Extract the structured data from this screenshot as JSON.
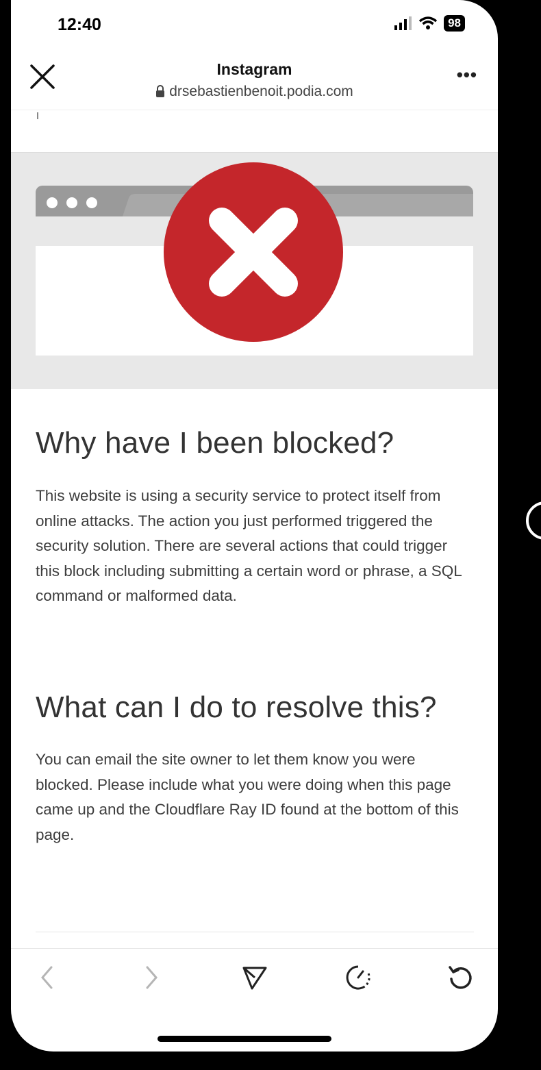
{
  "status_bar": {
    "time": "12:40",
    "battery": "98"
  },
  "nav": {
    "title": "Instagram",
    "url": "drsebastienbenoit.podia.com"
  },
  "page": {
    "heading1": "Why have I been blocked?",
    "paragraph1": "This website is using a security service to protect itself from online attacks. The action you just performed triggered the security solution. There are several actions that could trigger this block including submitting a certain word or phrase, a SQL command or malformed data.",
    "heading2": "What can I do to resolve this?",
    "paragraph2": "You can email the site owner to let them know you were blocked. Please include what you were doing when this page came up and the Cloudflare Ray ID found at the bottom of this page."
  },
  "colors": {
    "error_red": "#c4262b",
    "banner_bg": "#e8e8e8",
    "browser_bar": "#9a9a9a"
  },
  "icons": [
    "close-icon",
    "lock-icon",
    "more-icon",
    "signal-icon",
    "wifi-icon",
    "back-icon",
    "forward-icon",
    "share-icon",
    "timer-icon",
    "reload-icon"
  ]
}
